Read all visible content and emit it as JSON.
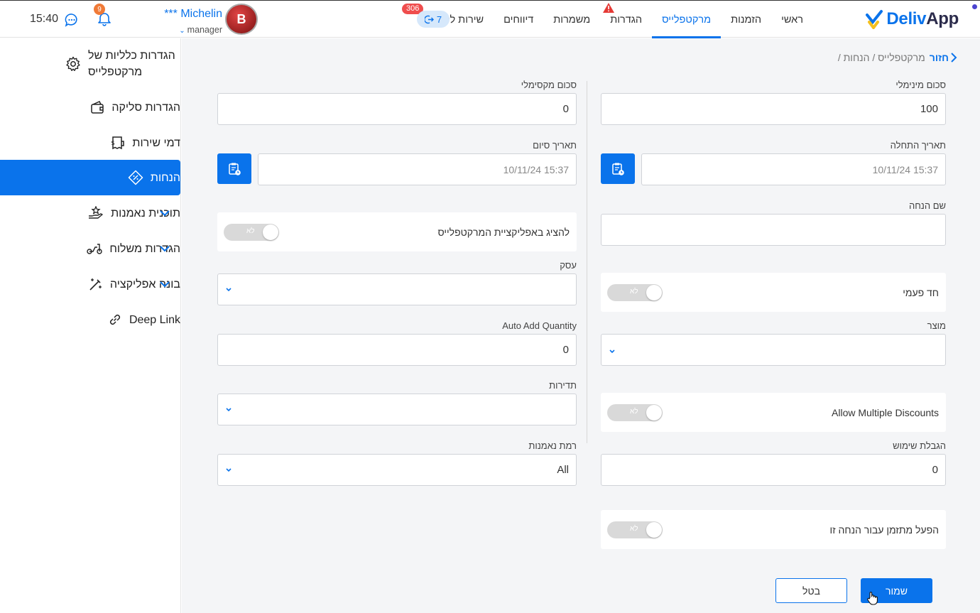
{
  "app": {
    "logo_prefix": "Deliv",
    "logo_suffix": "App",
    "time": "15:40",
    "notifications_count": "9"
  },
  "nav": {
    "items": [
      "ראשי",
      "הזמנות",
      "מרקטפלייס",
      "הגדרות",
      "משמרות",
      "דיווחים",
      "שירות לקוחות"
    ],
    "active": "מרקטפלייס",
    "customer_service_badge": "306",
    "customer_service_pill": "7"
  },
  "profile": {
    "name": "*** Michelin",
    "role": "manager",
    "avatar_letter": "B"
  },
  "sidebar": {
    "items": [
      {
        "label": "הגדרות כלליות של מרקטפלייס",
        "icon": "gear-icon"
      },
      {
        "label": "הגדרות סליקה",
        "icon": "wallet-icon"
      },
      {
        "label": "דמי שירות",
        "icon": "receipt-dollar-icon"
      },
      {
        "label": "הנחות",
        "icon": "discount-tag-icon",
        "active": true
      },
      {
        "label": "תוכנית נאמנות",
        "icon": "loyalty-hand-icon",
        "expandable": true
      },
      {
        "label": "הגדרות משלוח",
        "icon": "scooter-icon",
        "expandable": true
      },
      {
        "label": "בונה אפליקציה",
        "icon": "magic-wand-icon",
        "expandable": true
      },
      {
        "label": "Deep Link",
        "icon": "link-icon"
      }
    ]
  },
  "breadcrumb": {
    "back": "חזור",
    "path": "מרקטפלייס / הנחות /"
  },
  "form": {
    "min_amount": {
      "label": "סכום מינימלי",
      "value": "100"
    },
    "max_amount": {
      "label": "סכום מקסימלי",
      "value": "0"
    },
    "start_date": {
      "label": "תאריך התחלה",
      "value": "10/11/24 15:37"
    },
    "end_date": {
      "label": "תאריך סיום",
      "value": "10/11/24 15:37"
    },
    "discount_name": {
      "label": "שם הנחה",
      "value": ""
    },
    "show_in_app": {
      "label": "להציג באפליקציית המרקטפלייס",
      "state": "לא"
    },
    "one_time": {
      "label": "חד פעמי",
      "state": "לא"
    },
    "business": {
      "label": "עסק",
      "value": ""
    },
    "product": {
      "label": "מוצר",
      "value": ""
    },
    "auto_add_quantity": {
      "label": "Auto Add Quantity",
      "value": "0"
    },
    "allow_multiple": {
      "label": "Allow Multiple Discounts",
      "state": "לא"
    },
    "frequency": {
      "label": "תדירות",
      "value": ""
    },
    "usage_limit": {
      "label": "הגבלת שימוש",
      "value": "0"
    },
    "loyalty_level": {
      "label": "רמת נאמנות",
      "value": "All"
    },
    "scheduled": {
      "label": "הפעל מתזמן עבור הנחה זו",
      "state": "לא"
    }
  },
  "actions": {
    "save": "שמור",
    "cancel": "בטל"
  },
  "colors": {
    "accent": "#0a73eb",
    "badge_red": "#ef4d4d",
    "badge_orange": "#f07a37"
  }
}
